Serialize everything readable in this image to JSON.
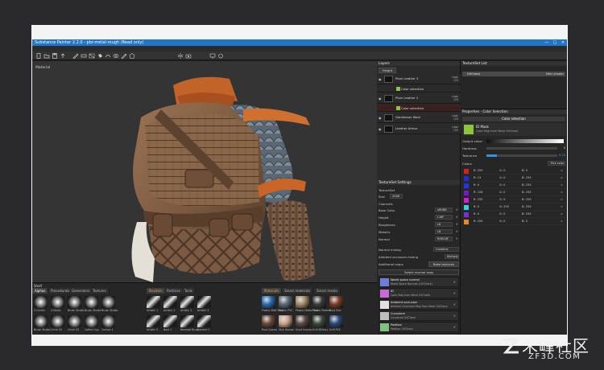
{
  "app": {
    "title": "Substance Painter 2.2.0 - pbr-metal-rough (Read only)",
    "window_buttons": [
      "—",
      "□",
      "✕"
    ]
  },
  "menu": [
    "File",
    "Edit",
    "Mode",
    "Viewport",
    "Plugins",
    "Help"
  ],
  "toolbar_icons": [
    "new-icon",
    "open-icon",
    "save-icon",
    "export-icon",
    "paint-icon",
    "eraser-icon",
    "projection-icon",
    "fill-icon",
    "smudge-icon",
    "clone-icon",
    "picker-icon",
    "polygon-fill-icon",
    "symmetry-icon",
    "camera-icon",
    "display-icon",
    "render-icon"
  ],
  "viewport": {
    "label": "Material"
  },
  "shelf": {
    "title": "Shelf",
    "tabs_group1": [
      "Alphas",
      "Procedurals",
      "Generators",
      "Textures"
    ],
    "tabs_group2": [
      "Brushes",
      "Particles",
      "Tools"
    ],
    "tabs_group3": [
      "Materials",
      "Smart materials",
      "Smart masks"
    ],
    "alphas": [
      "3 Circles",
      "4 Marks",
      "Brush Stroke",
      "Brush Stroke",
      "Brush Stroke",
      "Brush Stroke",
      "Circle 02",
      "Circle 03",
      "Coffee Cup",
      "Curtain 1",
      "Curtain 2"
    ],
    "brushes": [
      "Artistic 1",
      "Artistic 2",
      "Artistic 3",
      "Artistic 4",
      "Artistic 5",
      "Bark 1",
      "Basmati Brush",
      "Cement 1",
      "Cement 2"
    ],
    "materials": [
      "Plastic Matt Pure",
      "Plastic PVC",
      "Plastic Matte Pure",
      "Plastic Rubber",
      "Rust Fine",
      "Rust Coarse",
      "Skin Human",
      "Scarf Human",
      "Scifi Military",
      "Scifi PVC"
    ]
  },
  "layers": {
    "title": "Layers",
    "blend_select": "Height",
    "rows": [
      {
        "name": "Plain Leather 3",
        "blend": "Ldge",
        "opacity": "100"
      },
      {
        "name": "Color selection",
        "blend": "",
        "opacity": "",
        "sub": true
      },
      {
        "name": "Plain Leather 2",
        "blend": "Ldge",
        "opacity": "100"
      },
      {
        "name": "Color selection",
        "blend": "",
        "opacity": "",
        "sub": true,
        "selected": true
      },
      {
        "name": "Gambeson Wool",
        "blend": "Ldge",
        "opacity": "100"
      },
      {
        "name": "Leather Armor",
        "blend": "Ldge",
        "opacity": "100"
      }
    ]
  },
  "texture_set_settings": {
    "title": "TextureSet Settings",
    "set_name": "TextureSet",
    "size_label": "Size",
    "size_value": "2048",
    "channels_label": "Channels",
    "channels": [
      {
        "label": "Base Color",
        "value": "sRGB8"
      },
      {
        "label": "Height",
        "value": "L16F"
      },
      {
        "label": "Roughness",
        "value": "L8"
      },
      {
        "label": "Metallic",
        "value": "L8"
      },
      {
        "label": "Normal",
        "value": "RGB16F"
      }
    ],
    "normal_mixing_label": "Normal mixing",
    "normal_mixing_value": "Combine",
    "ao_label": "Ambient occlusion mixing",
    "ao_value": "Multiply",
    "additional_maps_label": "Additional maps",
    "bake_button": "Bake textures",
    "select_normal_map": "Select normal map",
    "maps": [
      {
        "name": "World space normal",
        "sub": "World Space Normals (UVCheck)"
      },
      {
        "name": "ID",
        "sub": "Color Map from Mesh UVCheck"
      },
      {
        "name": "Ambient occlusion",
        "sub": "Ambient Occlusion Map from Mesh UVCheck"
      },
      {
        "name": "Curvature",
        "sub": "Curvature UVCheck"
      },
      {
        "name": "Position",
        "sub": "Position UVCheck"
      },
      {
        "name": "Thickness",
        "sub": "Thickness Map from Mesh UVCheck"
      }
    ]
  },
  "texture_set_list": {
    "title": "TextureSet List",
    "row_name": "UVCheck",
    "row_shader": "Main shader"
  },
  "properties": {
    "title": "Properties - Color Selection",
    "section": "Color selection",
    "id_mask_title": "ID Mask",
    "id_mask_sub": "Color Map from Mesh UVCheck",
    "output_label": "Output value",
    "hardness_label": "Hardness",
    "hardness_value": "0",
    "tolerance_label": "Tolerance",
    "tolerance_value": "0.15",
    "colors_label": "Colors",
    "pick_button": "Pick color",
    "colors": [
      {
        "hex": "#e01d1d",
        "r": "R: 255",
        "g": "G: 0",
        "b": "B: 0"
      },
      {
        "hex": "#1a2fd6",
        "r": "R: 13",
        "g": "G: 0",
        "b": "B: 255"
      },
      {
        "hex": "#2136e0",
        "r": "R: 0",
        "g": "G: 0",
        "b": "B: 255"
      },
      {
        "hex": "#7a16c9",
        "r": "R: 128",
        "g": "G: 0",
        "b": "B: 255"
      },
      {
        "hex": "#d71ed7",
        "r": "R: 255",
        "g": "G: 0",
        "b": "B: 255"
      },
      {
        "hex": "#2fd6df",
        "r": "R: 0",
        "g": "G: 255",
        "b": "B: 255"
      },
      {
        "hex": "#7b2fd2",
        "r": "R: 0",
        "g": "G: 0",
        "b": "B: 255"
      },
      {
        "hex": "#e08d20",
        "r": "R: 255",
        "g": "G: 0",
        "b": "B: 0"
      }
    ]
  },
  "watermark": {
    "brand_cn": "朱峰社区",
    "url": "ZF3D.COM"
  },
  "theme": {
    "title_blue": "#2276c9",
    "panel_bg": "#262626",
    "viewport_bg": "#343434"
  }
}
